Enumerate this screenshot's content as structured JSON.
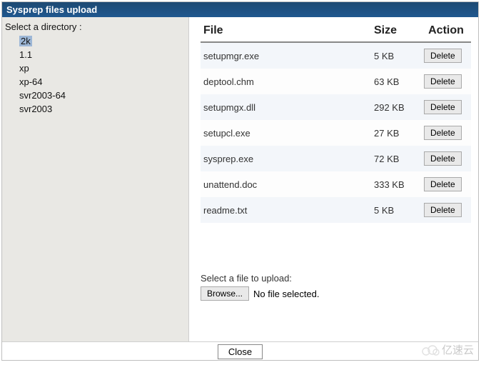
{
  "window": {
    "title": "Sysprep files upload"
  },
  "sidebar": {
    "title": "Select a directory :",
    "items": [
      {
        "label": "2k",
        "selected": true
      },
      {
        "label": "1.1",
        "selected": false
      },
      {
        "label": "xp",
        "selected": false
      },
      {
        "label": "xp-64",
        "selected": false
      },
      {
        "label": "svr2003-64",
        "selected": false
      },
      {
        "label": "svr2003",
        "selected": false
      }
    ]
  },
  "table": {
    "headers": {
      "file": "File",
      "size": "Size",
      "action": "Action"
    },
    "action_label": "Delete",
    "rows": [
      {
        "file": "setupmgr.exe",
        "size": "5 KB"
      },
      {
        "file": "deptool.chm",
        "size": "63 KB"
      },
      {
        "file": "setupmgx.dll",
        "size": "292 KB"
      },
      {
        "file": "setupcl.exe",
        "size": "27 KB"
      },
      {
        "file": "sysprep.exe",
        "size": "72 KB"
      },
      {
        "file": "unattend.doc",
        "size": "333 KB"
      },
      {
        "file": "readme.txt",
        "size": "5 KB"
      }
    ]
  },
  "upload": {
    "hint": "Select a file to upload:",
    "browse_label": "Browse...",
    "no_file": "No file selected."
  },
  "footer": {
    "close_label": "Close"
  },
  "watermark": {
    "text": "亿速云"
  }
}
